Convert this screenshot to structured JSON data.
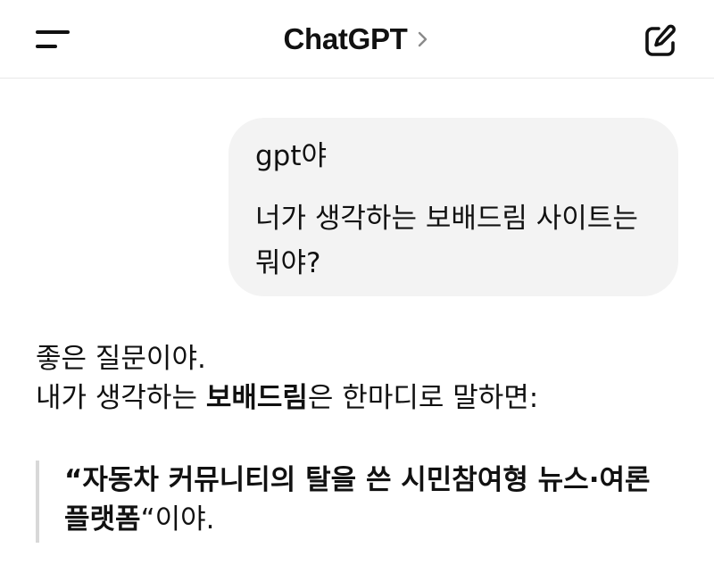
{
  "header": {
    "title": "ChatGPT",
    "icons": {
      "menu": "menu-icon",
      "chevron": "chevron-right-icon",
      "new_chat": "new-chat-icon"
    }
  },
  "conversation": {
    "user_message": {
      "line1": "gpt야",
      "line2": "너가 생각하는 보배드림 사이트는",
      "line3": "뭐야?"
    },
    "assistant_message": {
      "line1": "좋은 질문이야.",
      "line2_prefix": "내가 생각하는 ",
      "line2_bold": "보배드림",
      "line2_suffix": "은 한마디로 말하면:",
      "quote_bold_1": "“자동차 커뮤니티의 탈을 쓴 시민참여형 뉴스·여론",
      "quote_bold_2": "플랫폼",
      "quote_suffix": "“이야."
    }
  },
  "colors": {
    "bubble_bg": "#f3f3f3",
    "text": "#111111",
    "divider": "#e8e8e8",
    "quote_bar": "#d8d8d8"
  }
}
